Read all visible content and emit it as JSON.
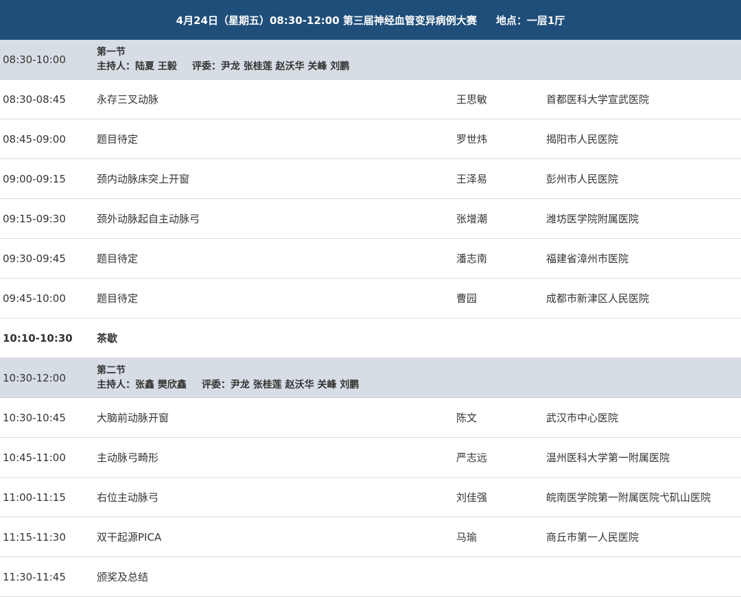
{
  "header": {
    "title": "4月24日（星期五）08:30-12:00 第三届神经血管变异病例大赛",
    "location": "地点：一层1厅"
  },
  "sessions": [
    {
      "time": "08:30-10:00",
      "name": "第一节",
      "hosts": "主持人：陆夏 王毅",
      "judges": "评委：尹龙 张桂莲 赵沃华 关峰 刘鹏",
      "talks": [
        {
          "time": "08:30-08:45",
          "title": "永存三叉动脉",
          "speaker": "王思敏",
          "hospital": "首都医科大学宣武医院"
        },
        {
          "time": "08:45-09:00",
          "title": "题目待定",
          "speaker": "罗世炜",
          "hospital": "揭阳市人民医院"
        },
        {
          "time": "09:00-09:15",
          "title": "颈内动脉床突上开窗",
          "speaker": "王泽易",
          "hospital": "彭州市人民医院"
        },
        {
          "time": "09:15-09:30",
          "title": "颈外动脉起自主动脉弓",
          "speaker": "张增潮",
          "hospital": "潍坊医学院附属医院"
        },
        {
          "time": "09:30-09:45",
          "title": "题目待定",
          "speaker": "潘志南",
          "hospital": "福建省漳州市医院"
        },
        {
          "time": "09:45-10:00",
          "title": "题目待定",
          "speaker": "曹园",
          "hospital": "成都市新津区人民医院"
        }
      ]
    },
    {
      "time": "10:30-12:00",
      "name": "第二节",
      "hosts": "主持人：张鑫 樊欣鑫",
      "judges": "评委：尹龙 张桂莲 赵沃华 关峰 刘鹏",
      "talks": [
        {
          "time": "10:30-10:45",
          "title": "大脑前动脉开窗",
          "speaker": "陈文",
          "hospital": "武汉市中心医院"
        },
        {
          "time": "10:45-11:00",
          "title": "主动脉弓畸形",
          "speaker": "严志远",
          "hospital": "温州医科大学第一附属医院"
        },
        {
          "time": "11:00-11:15",
          "title": "右位主动脉弓",
          "speaker": "刘佳强",
          "hospital": "皖南医学院第一附属医院弋矶山医院"
        },
        {
          "time": "11:15-11:30",
          "title": "双干起源PICA",
          "speaker": "马瑜",
          "hospital": "商丘市第一人民医院"
        },
        {
          "time": "11:30-11:45",
          "title": "颁奖及总结",
          "speaker": "",
          "hospital": ""
        }
      ]
    }
  ],
  "break": {
    "time": "10:10-10:30",
    "label": "茶歇"
  }
}
